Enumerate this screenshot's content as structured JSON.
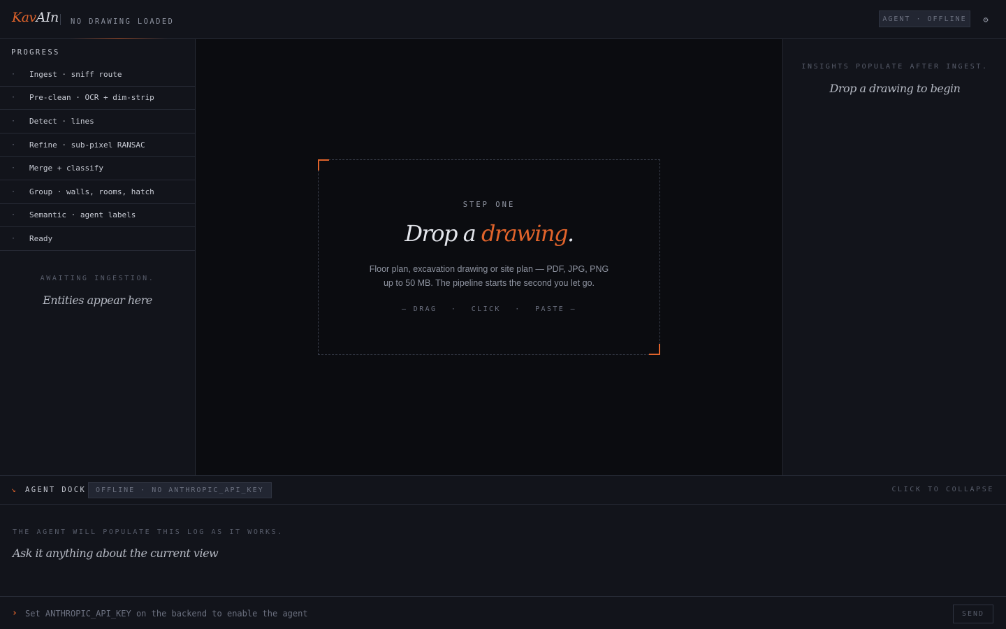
{
  "header": {
    "logo_k": "Kav",
    "logo_rest": "AIn",
    "drawing_status": "NO DRAWING LOADED",
    "agent_status": "AGENT · OFFLINE",
    "settings_icon": "gear-icon"
  },
  "colors": {
    "accent": "#e0632b",
    "background": "#12141b",
    "canvas": "#0b0c10"
  },
  "sidebar": {
    "heading": "PROGRESS",
    "steps": [
      {
        "bullet": "·",
        "label": "Ingest · sniff route"
      },
      {
        "bullet": "·",
        "label": "Pre-clean · OCR + dim-strip"
      },
      {
        "bullet": "·",
        "label": "Detect · lines"
      },
      {
        "bullet": "·",
        "label": "Refine · sub-pixel RANSAC"
      },
      {
        "bullet": "·",
        "label": "Merge + classify"
      },
      {
        "bullet": "·",
        "label": "Group · walls, rooms, hatch"
      },
      {
        "bullet": "·",
        "label": "Semantic · agent labels"
      },
      {
        "bullet": "·",
        "label": "Ready"
      }
    ],
    "empty_note": "AWAITING INGESTION.",
    "empty_title": "Entities appear here"
  },
  "dropzone": {
    "step": "STEP ONE",
    "title_plain": "Drop a ",
    "title_accent": "drawing",
    "title_end": ".",
    "desc_line1": "Floor plan, excavation drawing or site plan — PDF, JPG, PNG",
    "desc_line2": "up to 50 MB. The pipeline starts the second you let go.",
    "action_drag": "— DRAG",
    "action_sep": "·",
    "action_click": "CLICK",
    "action_paste": "PASTE —"
  },
  "insights": {
    "note": "INSIGHTS POPULATE AFTER INGEST.",
    "title": "Drop a drawing to begin"
  },
  "dock": {
    "title": "AGENT DOCK",
    "badge": "OFFLINE · NO ANTHROPIC_API_KEY",
    "collapse": "CLICK TO COLLAPSE",
    "log_note": "THE AGENT WILL POPULATE THIS LOG AS IT WORKS.",
    "log_title": "Ask it anything about the current view",
    "input_placeholder": "Set ANTHROPIC_API_KEY on the backend to enable the agent",
    "input_value": "",
    "send_label": "SEND"
  }
}
